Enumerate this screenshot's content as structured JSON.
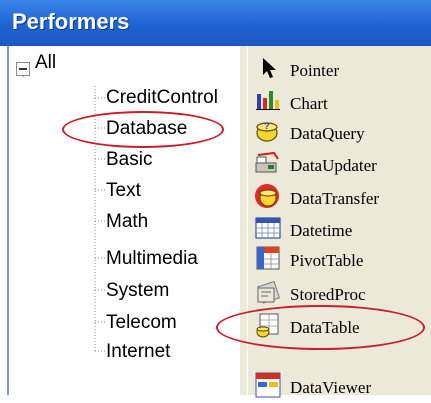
{
  "window": {
    "title": "Performers"
  },
  "tree": {
    "root_label": "All",
    "nodes": [
      {
        "label": "CreditControl"
      },
      {
        "label": "Database"
      },
      {
        "label": "Basic"
      },
      {
        "label": "Text"
      },
      {
        "label": "Math"
      },
      {
        "label": "Multimedia"
      },
      {
        "label": "System"
      },
      {
        "label": "Telecom"
      },
      {
        "label": "Internet"
      }
    ]
  },
  "toolbox": {
    "items": [
      {
        "label": "Pointer",
        "icon": "pointer-arrow-icon"
      },
      {
        "label": "Chart",
        "icon": "chart-icon"
      },
      {
        "label": "DataQuery",
        "icon": "dataquery-icon"
      },
      {
        "label": "DataUpdater",
        "icon": "dataupdater-icon"
      },
      {
        "label": "DataTransfer",
        "icon": "datatransfer-icon"
      },
      {
        "label": "Datetime",
        "icon": "datetime-icon"
      },
      {
        "label": "PivotTable",
        "icon": "pivottable-icon"
      },
      {
        "label": "StoredProc",
        "icon": "storedproc-icon"
      },
      {
        "label": "DataTable",
        "icon": "datatable-icon"
      },
      {
        "label": "DataViewer",
        "icon": "dataviewer-icon"
      }
    ]
  },
  "annotations": {
    "highlight_color": "#c8202a"
  },
  "colors": {
    "title_bar": "#1f63d1",
    "panel_bg": "#ece9d8",
    "title_text": "#ffffff"
  }
}
